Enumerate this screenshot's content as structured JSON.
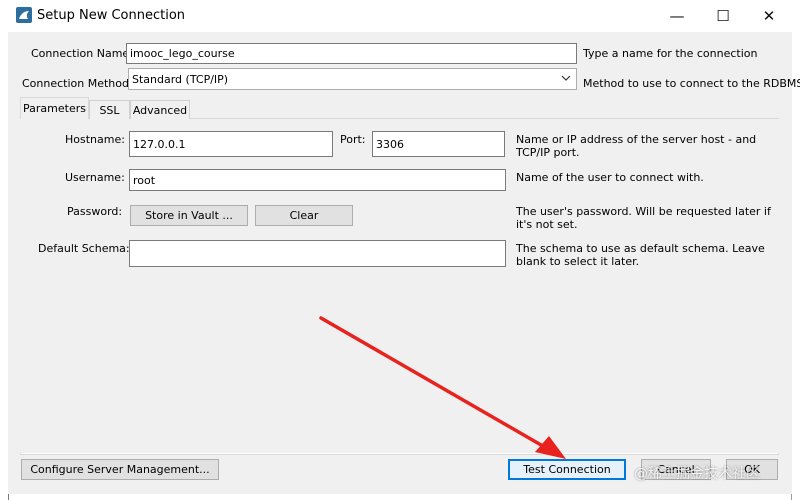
{
  "window": {
    "title": "Setup New Connection",
    "minimize_glyph": "—",
    "maximize_glyph": "☐",
    "close_glyph": "✕"
  },
  "connection": {
    "name_label": "Connection Name:",
    "name_value": "imooc_lego_course",
    "name_help": "Type a name for the connection",
    "method_label": "Connection Method:",
    "method_value": "Standard (TCP/IP)",
    "method_help": "Method to use to connect to the RDBMS"
  },
  "tabs": [
    {
      "label": "Parameters",
      "active": true
    },
    {
      "label": "SSL",
      "active": false
    },
    {
      "label": "Advanced",
      "active": false
    }
  ],
  "params": {
    "hostname_label": "Hostname:",
    "hostname_value": "127.0.0.1",
    "port_label": "Port:",
    "port_value": "3306",
    "hostname_help": "Name or IP address of the server host - and TCP/IP port.",
    "username_label": "Username:",
    "username_value": "root",
    "username_help": "Name of the user to connect with.",
    "password_label": "Password:",
    "store_vault_label": "Store in Vault ...",
    "clear_label": "Clear",
    "password_help": "The user's password. Will be requested later if it's not set.",
    "schema_label": "Default Schema:",
    "schema_value": "",
    "schema_help": "The schema to use as default schema. Leave blank to select it later."
  },
  "footer": {
    "configure_label": "Configure Server Management...",
    "test_label": "Test Connection",
    "cancel_label": "Cancel",
    "ok_label": "OK"
  },
  "watermark": "@稀土掘金技术社区",
  "colors": {
    "accent": "#0078d7",
    "arrow": "#e8231f",
    "app_icon": "#2d6e9e"
  }
}
